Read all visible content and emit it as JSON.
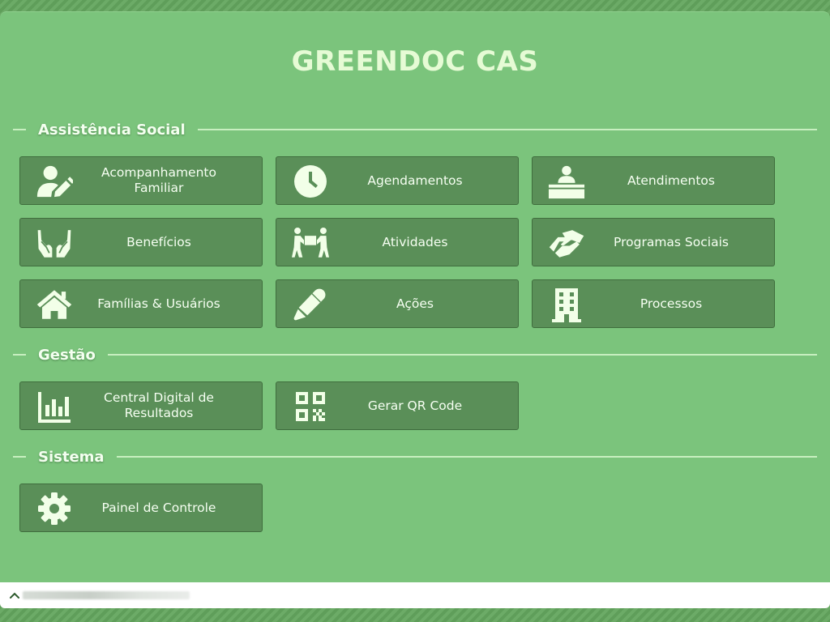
{
  "app": {
    "title": "GREENDOC CAS"
  },
  "colors": {
    "panel_bg": "#7bc47c",
    "tile_bg": "#5a8f58",
    "tile_border": "#3f6d3d",
    "title_text": "#e6fbd5",
    "icon_fill": "#f2ffe8"
  },
  "sections": [
    {
      "label": "Assistência Social",
      "tiles": [
        {
          "label": "Acompanhamento\nFamiliar",
          "icon": "user-edit-icon"
        },
        {
          "label": "Agendamentos",
          "icon": "clock-icon"
        },
        {
          "label": "Atendimentos",
          "icon": "reception-desk-icon"
        },
        {
          "label": "Benefícios",
          "icon": "hands-icon"
        },
        {
          "label": "Atividades",
          "icon": "people-carry-icon"
        },
        {
          "label": "Programas Sociais",
          "icon": "handshake-icon"
        },
        {
          "label": "Famílias & Usuários",
          "icon": "home-icon"
        },
        {
          "label": "Ações",
          "icon": "pen-icon"
        },
        {
          "label": "Processos",
          "icon": "building-icon"
        }
      ]
    },
    {
      "label": "Gestão",
      "tiles": [
        {
          "label": "Central Digital de\nResultados",
          "icon": "bar-chart-icon"
        },
        {
          "label": "Gerar QR Code",
          "icon": "qrcode-icon"
        }
      ]
    },
    {
      "label": "Sistema",
      "tiles": [
        {
          "label": "Painel de Controle",
          "icon": "gear-icon"
        }
      ]
    }
  ],
  "bottom_bar": {
    "toggle_icon": "chevron-up-icon"
  }
}
